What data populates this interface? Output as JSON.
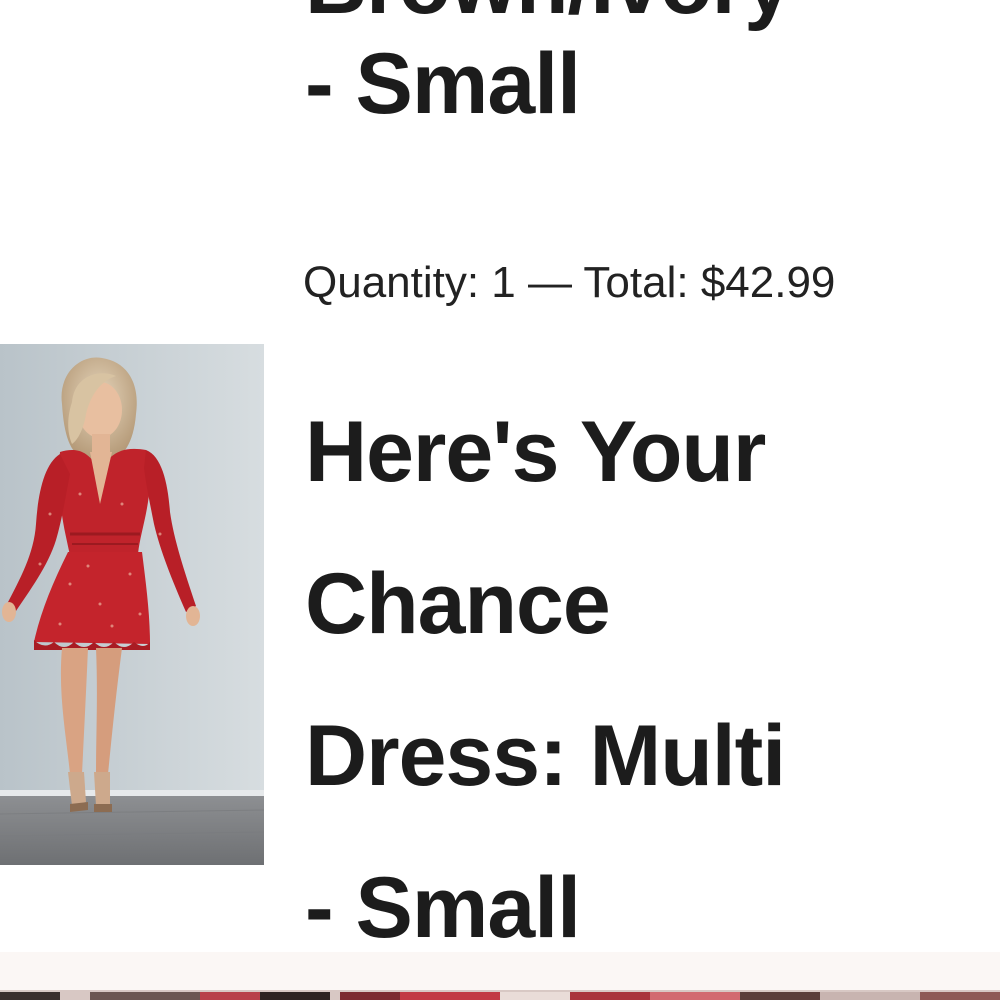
{
  "previous_item": {
    "title_lines": [
      "Brown/Ivory",
      "- Small"
    ],
    "meta": "Quantity: 1 — Total: $42.99"
  },
  "current_item": {
    "title_lines": [
      "Here's Your",
      "Chance",
      "Dress: Multi",
      "- Small"
    ]
  }
}
